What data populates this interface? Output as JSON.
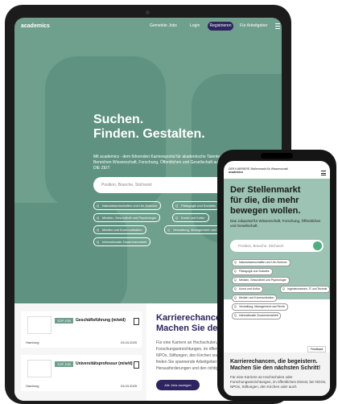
{
  "tablet": {
    "logo": "academics",
    "nav": [
      "Gemerkte Jobs",
      "Login",
      "Registrieren",
      "Für Arbeitgeber"
    ],
    "hero": [
      "Suchen.",
      "Finden. Gestalten."
    ],
    "subtitle": "Mit academics - dem führenden Karriereportal für akademische Talente aus den Bereichen Wissenschaft, Forschung, Öffentlichen und Gesellschaft aus dem Hause DIE ZEIT",
    "search_placeholder": "Position, Branche, Stichwort",
    "chips": [
      "Naturwissenschaften und Life-Science",
      "Pädagogik und Soziales",
      "Medizin, Gesundheit und Psychologie",
      "Kunst und Kultur",
      "Medien und Kommunikation",
      "Verwaltung, Management und Recht",
      "Internationale Zusammenarbeit"
    ],
    "jobs": [
      {
        "badge": "TOP JOB",
        "title": "Geschäftsführung (m/w/d)",
        "location": "Hamburg",
        "date": "03.03.2025"
      },
      {
        "badge": "TOP JOB",
        "title": "Universitätsprofessur (m/w/d)",
        "location": "Hamburg",
        "date": "03.03.2025"
      }
    ],
    "career_heading": [
      "Karrierechancen, die",
      "Machen Sie den n"
    ],
    "career_text": "Für eine Karriere an Hochschulen, Forschungseinrichtungen, im öffentlichen NPOs, Stiftungen, den Kirchen sowie. Hier finden Sie spannende Arbeitgeber Herausforderungen und den richtigen",
    "all_jobs_button": "Alle Jobs anzeigen"
  },
  "phone": {
    "top_text": "DER KARRIERE Stellenmarkt für Wissenschaft",
    "logo": "academics",
    "heading": [
      "Der Stellenmarkt",
      "für die, die mehr",
      "bewegen wollen."
    ],
    "subtitle": "Das Jobportal für Wissenschaft, Forschung, Öffentliches und Gesellschaft.",
    "search_placeholder": "Position, Branche, Stichwort",
    "chips": [
      "Naturwissenschaften und Life-Science",
      "Pädagogik und Soziales",
      "Medizin, Gesundheit und Psychologie",
      "Kunst und Kultur",
      "Ingenieurwesen, IT und Technik",
      "Medien und Kommunikation",
      "Verwaltung, Management und Recht",
      "Internationale Zusammenarbeit"
    ],
    "tooltip": "Feedback",
    "bottom_heading": "Karrierechancen, die begeistern. Machen Sie den nächsten Schritt!",
    "bottom_text": "Für eine Karriere an Hochschulen oder Forschungseinrichtungen, im öffentlichen Dienst, bei NGOs, NPOs, Stiftungen, den Kirchen oder auch"
  },
  "colors": {
    "accent": "#6fa08e",
    "brand": "#2d2460"
  }
}
